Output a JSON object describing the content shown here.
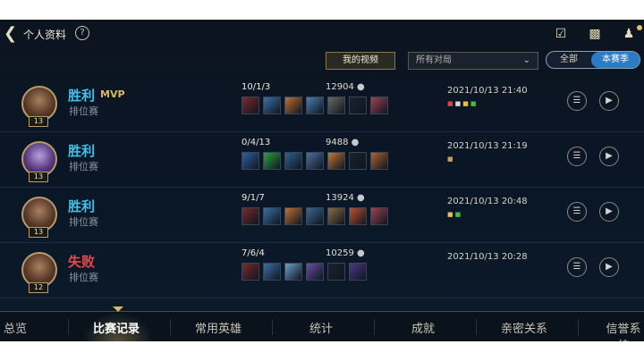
{
  "header": {
    "title": "个人资料",
    "help": "?",
    "icons": [
      "back-chevron-icon",
      "clipboard-icon",
      "chat-icon",
      "friends-icon"
    ]
  },
  "controls": {
    "video_button": "我的视频",
    "mode_select": "所有对局",
    "season_toggle": [
      "全部",
      "本赛季"
    ],
    "season_selected": "本赛季"
  },
  "matches": [
    {
      "result": "胜利",
      "outcome": "win",
      "mvp": "MVP",
      "queue": "排位赛",
      "level": "13",
      "kda": "10/1/3",
      "gold": "12904",
      "time": "2021/10/13 21:40",
      "items": [
        "#7a2a2a",
        "#3a70a8",
        "#c07030",
        "#4a80b0",
        "#6a6a60",
        "#1a2230",
        "#a04050"
      ],
      "marks": [
        "#e04040",
        "#d8d8d8",
        "#e8c040",
        "#40c040"
      ]
    },
    {
      "result": "胜利",
      "outcome": "win",
      "mvp": "",
      "queue": "排位赛",
      "level": "13",
      "kda": "0/4/13",
      "gold": "9488",
      "time": "2021/10/13 21:19",
      "items": [
        "#3060a0",
        "#30a040",
        "#30608a",
        "#5070a0",
        "#c07830",
        "#1a2230",
        "#b06030"
      ],
      "marks": [
        "#d0a040"
      ]
    },
    {
      "result": "胜利",
      "outcome": "win",
      "mvp": "",
      "queue": "排位赛",
      "level": "13",
      "kda": "9/1/7",
      "gold": "13924",
      "time": "2021/10/13 20:48",
      "items": [
        "#7a2a2a",
        "#3a70a8",
        "#c07030",
        "#3a6890",
        "#8a6a40",
        "#c05030",
        "#a04050"
      ],
      "marks": [
        "#e8c040",
        "#40c040"
      ]
    },
    {
      "result": "失败",
      "outcome": "lose",
      "mvp": "",
      "queue": "排位赛",
      "level": "12",
      "kda": "7/6/4",
      "gold": "10259",
      "time": "2021/10/13 20:28",
      "items": [
        "#7a2a2a",
        "#3a70a8",
        "#6aa0c8",
        "#6a50a0",
        "#1a2230",
        "#4a3a80"
      ],
      "marks": []
    }
  ],
  "bottom_nav": [
    "总览",
    "比赛记录",
    "常用英雄",
    "统计",
    "成就",
    "亲密关系",
    "信誉系统"
  ],
  "bottom_nav_active": "比赛记录",
  "colors": {
    "win": "#3fc0e8",
    "lose": "#e84848",
    "accent": "#2b7cc4"
  }
}
